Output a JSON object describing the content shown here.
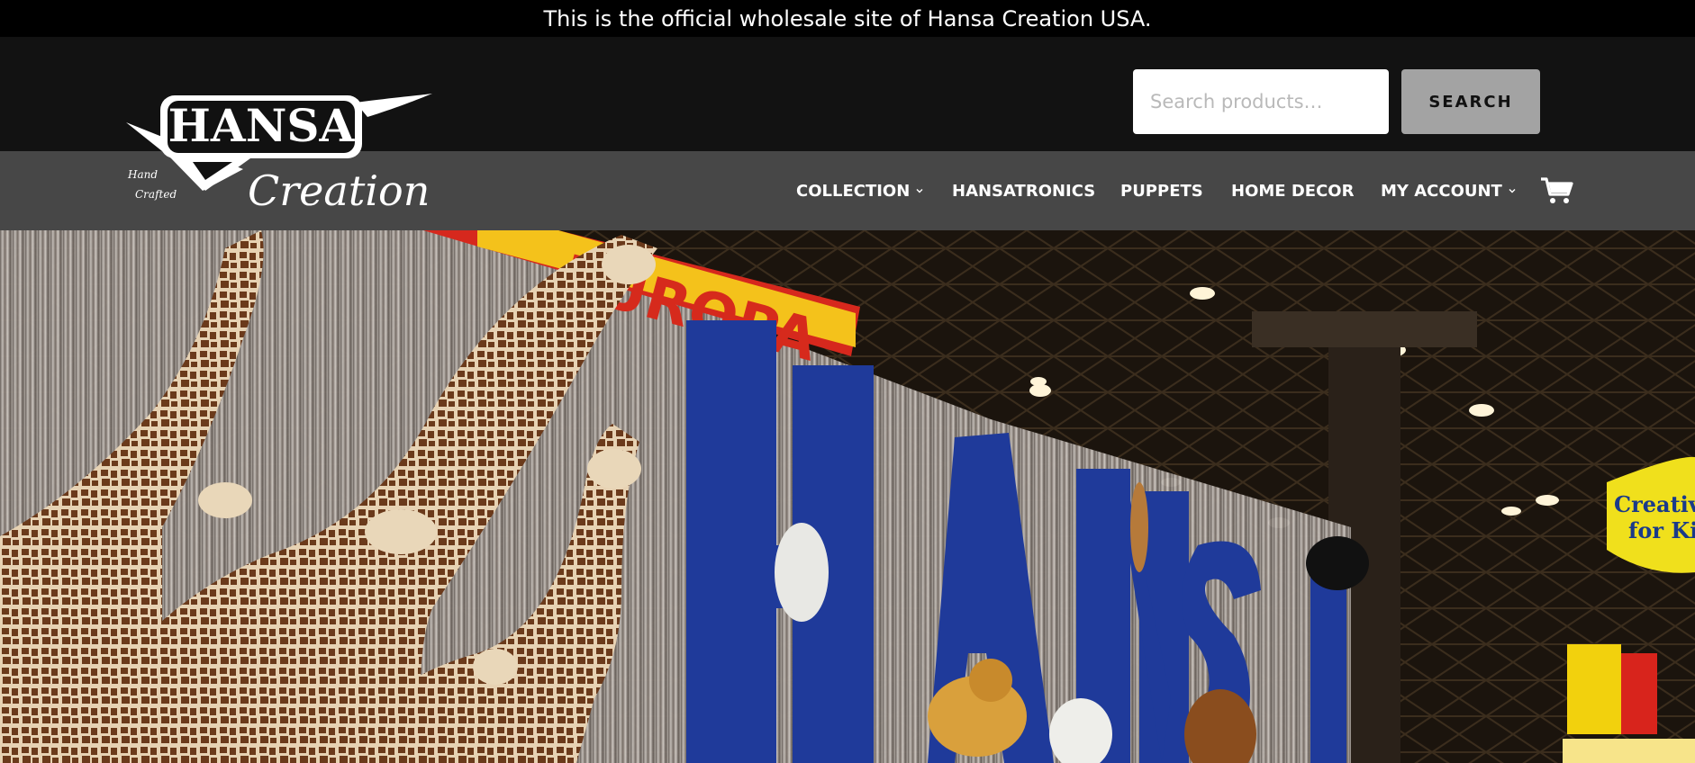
{
  "announcement": "This is the official wholesale site of Hansa Creation USA.",
  "logo": {
    "brand": "HANSA",
    "script": "Creation",
    "tagline_1": "Hand",
    "tagline_2": "Crafted"
  },
  "search": {
    "placeholder": "Search products…",
    "value": "",
    "button_label": "SEARCH"
  },
  "nav": {
    "items": [
      {
        "label": "COLLECTION",
        "has_dropdown": true
      },
      {
        "label": "HANSATRONICS",
        "has_dropdown": false
      },
      {
        "label": "PUPPETS",
        "has_dropdown": false
      },
      {
        "label": "HOME DECOR",
        "has_dropdown": false
      },
      {
        "label": "MY ACCOUNT",
        "has_dropdown": true
      }
    ],
    "cart_icon": "shopping-cart-icon"
  },
  "hero": {
    "sign_red": "EUROPA",
    "sign_right_1": "Creativity",
    "sign_right_2": "for Kids",
    "display_letters": "HANSA"
  },
  "colors": {
    "announcement_bg": "#000000",
    "header_bg": "#121212",
    "nav_bg": "#474747",
    "search_button_bg": "#a3a3a3",
    "hero_letters": "#1f3a9a"
  }
}
